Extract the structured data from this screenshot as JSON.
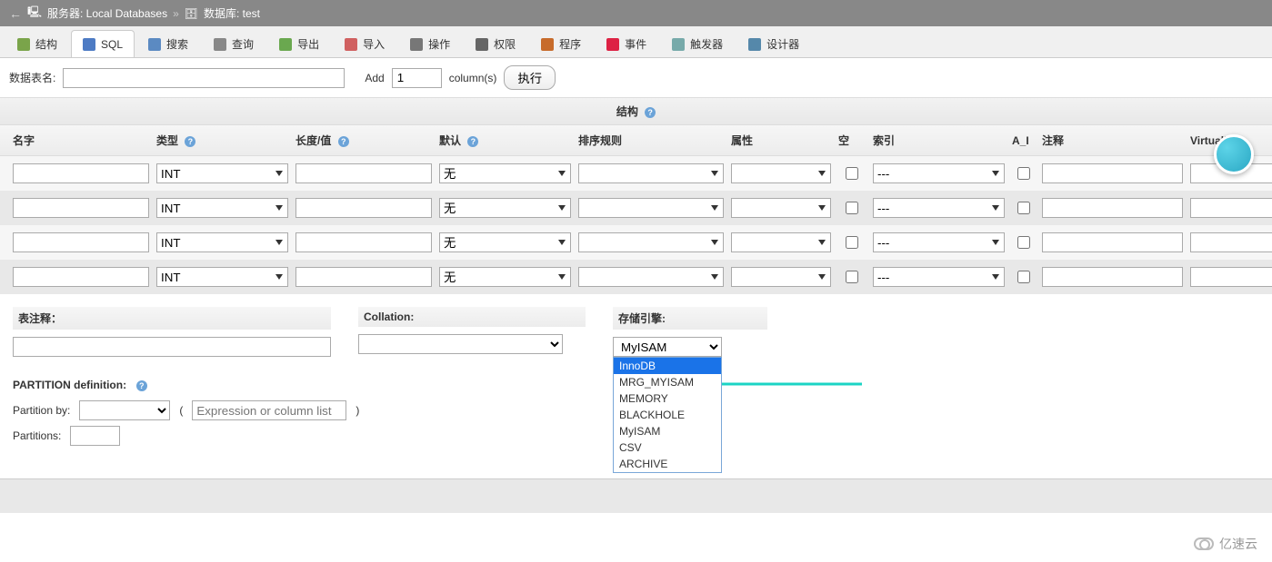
{
  "breadcrumb": {
    "back_arrow": "←",
    "server_icon": "🖥",
    "server_label": "服务器: Local Databases",
    "sep": "»",
    "db_icon": "🗄",
    "db_label": "数据库: test"
  },
  "tabs": [
    {
      "id": "structure",
      "label": "结构",
      "icon": "#7aa44a"
    },
    {
      "id": "sql",
      "label": "SQL",
      "icon": "#4d7bc4",
      "active": true
    },
    {
      "id": "search",
      "label": "搜索",
      "icon": "#5b8ac2"
    },
    {
      "id": "query",
      "label": "查询",
      "icon": "#888"
    },
    {
      "id": "export",
      "label": "导出",
      "icon": "#6aa84f"
    },
    {
      "id": "import",
      "label": "导入",
      "icon": "#d06060"
    },
    {
      "id": "operations",
      "label": "操作",
      "icon": "#777"
    },
    {
      "id": "privileges",
      "label": "权限",
      "icon": "#666"
    },
    {
      "id": "routines",
      "label": "程序",
      "icon": "#c76b2b"
    },
    {
      "id": "events",
      "label": "事件",
      "icon": "#d24"
    },
    {
      "id": "triggers",
      "label": "触发器",
      "icon": "#7aa"
    },
    {
      "id": "designer",
      "label": "设计器",
      "icon": "#58a"
    }
  ],
  "add_row": {
    "table_name_label": "数据表名:",
    "table_name_value": "",
    "add_label": "Add",
    "count_value": "1",
    "columns_label": "column(s)",
    "exec_btn": "执行"
  },
  "structure_header": "结构",
  "col_headers": {
    "name": "名字",
    "type": "类型",
    "length": "长度/值",
    "default": "默认",
    "collation": "排序规则",
    "attr": "属性",
    "null": "空",
    "index": "索引",
    "ai": "A_I",
    "comments": "注释",
    "virtuality": "Virtuality"
  },
  "rows": [
    {
      "type": "INT",
      "default": "无",
      "index": "---"
    },
    {
      "type": "INT",
      "default": "无",
      "index": "---"
    },
    {
      "type": "INT",
      "default": "无",
      "index": "---"
    },
    {
      "type": "INT",
      "default": "无",
      "index": "---"
    }
  ],
  "bottom": {
    "comment_label": "表注释：",
    "comment_value": "",
    "collation_label": "Collation:",
    "collation_value": "",
    "engine_label": "存储引擎:",
    "engine_value": "MyISAM",
    "engine_options": [
      "InnoDB",
      "MRG_MYISAM",
      "MEMORY",
      "BLACKHOLE",
      "MyISAM",
      "CSV",
      "ARCHIVE"
    ],
    "engine_selected_in_list": "InnoDB"
  },
  "partition": {
    "title": "PARTITION definition:",
    "by_label": "Partition by:",
    "expr_placeholder": "Expression or column list",
    "count_label": "Partitions:"
  },
  "watermark": "亿速云"
}
